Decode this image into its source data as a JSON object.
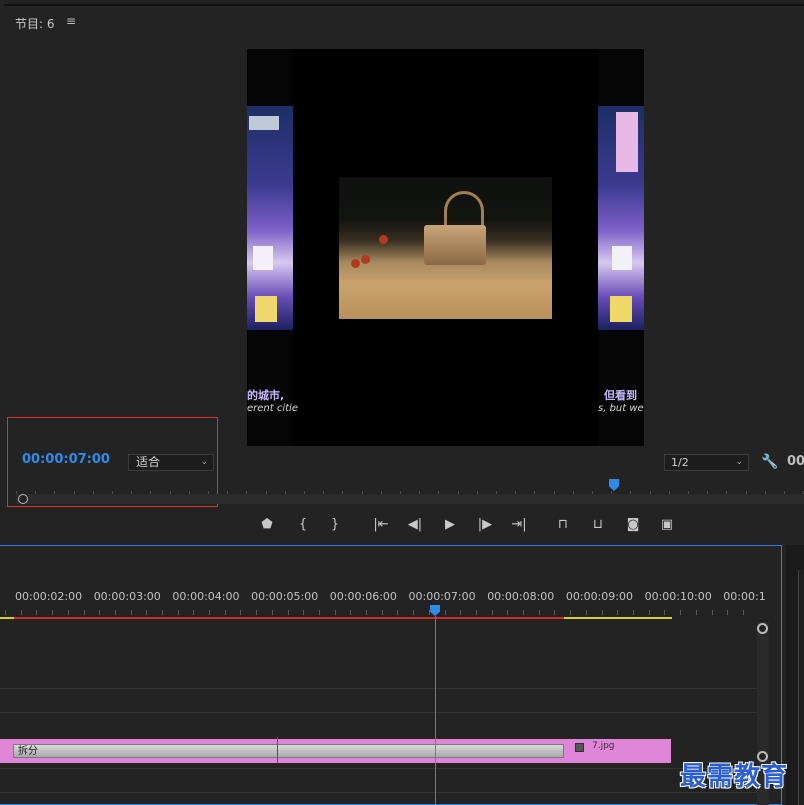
{
  "monitor": {
    "title": "节目: 6",
    "menu_icon": "hamburger-icon",
    "timecode": "00:00:07:00",
    "fit_select": "适合",
    "resolution_select": "1/2",
    "timecode_right": "00:",
    "settings_icon": "wrench-icon",
    "highlight_color": "#e0322a"
  },
  "video": {
    "left_subtitle_cn": "的城市,",
    "left_subtitle_en": "erent citie",
    "right_subtitle_cn": "但看到",
    "right_subtitle_en": "s, but we s"
  },
  "transport": {
    "buttons": [
      {
        "name": "add-marker-icon",
        "glyph": "⬟"
      },
      {
        "name": "mark-in-icon",
        "glyph": "{"
      },
      {
        "name": "mark-out-icon",
        "glyph": "}"
      },
      {
        "name": "go-to-in-icon",
        "glyph": "|⇤"
      },
      {
        "name": "step-back-icon",
        "glyph": "◀|"
      },
      {
        "name": "play-icon",
        "glyph": "▶"
      },
      {
        "name": "step-forward-icon",
        "glyph": "|▶"
      },
      {
        "name": "go-to-out-icon",
        "glyph": "⇥|"
      },
      {
        "name": "lift-icon",
        "glyph": "⊓"
      },
      {
        "name": "extract-icon",
        "glyph": "⊔"
      },
      {
        "name": "export-frame-icon",
        "glyph": "◙"
      },
      {
        "name": "comparison-view-icon",
        "glyph": "▣"
      }
    ]
  },
  "timeline": {
    "ruler_labels": [
      "00:00:02:00",
      "00:00:03:00",
      "00:00:04:00",
      "00:00:05:00",
      "00:00:06:00",
      "00:00:07:00",
      "00:00:08:00",
      "00:00:09:00",
      "00:00:10:00",
      "00:00:1"
    ],
    "clip_label": "拆分",
    "clip2_label": "7.jpg",
    "accent": "#2d8ceb",
    "clip_color": "#e086d9"
  },
  "watermark": "最需教育"
}
